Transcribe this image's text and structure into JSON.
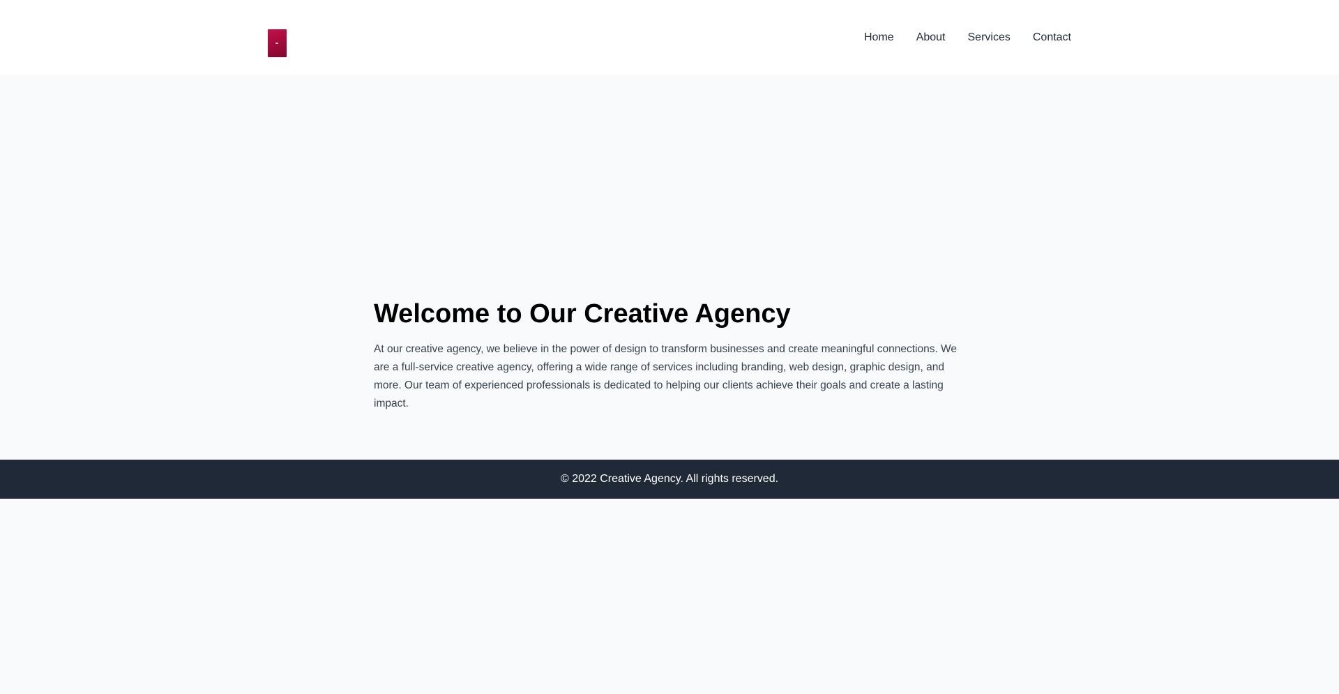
{
  "header": {
    "logo_icon": "crimson-logo-image",
    "nav": [
      {
        "label": "Home"
      },
      {
        "label": "About"
      },
      {
        "label": "Services"
      },
      {
        "label": "Contact"
      }
    ]
  },
  "hero": {
    "title": "Welcome to Our Creative Agency",
    "body": "At our creative agency, we believe in the power of design to transform businesses and create meaningful connections. We are a full-service creative agency, offering a wide range of services including branding, web design, graphic design, and more. Our team of experienced professionals is dedicated to helping our clients achieve their goals and create a lasting impact."
  },
  "footer": {
    "copyright": "© 2022 Creative Agency. All rights reserved."
  },
  "colors": {
    "page_background": "#f9fafb",
    "header_background": "#ffffff",
    "footer_background": "#1f2937",
    "logo_accent": "#b00d42"
  }
}
